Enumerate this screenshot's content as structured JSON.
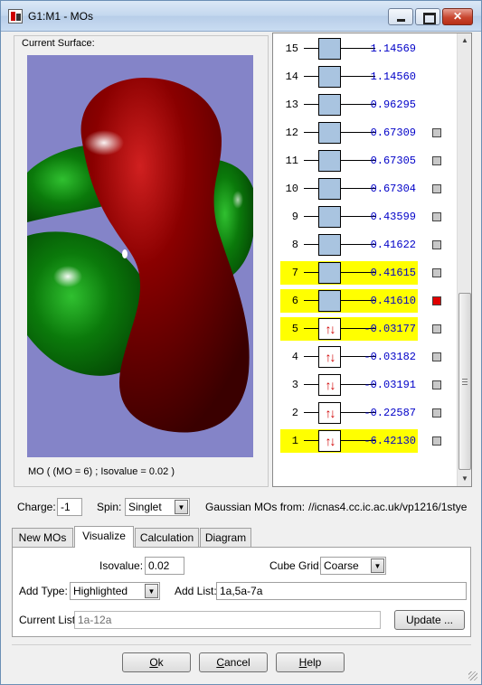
{
  "window": {
    "title": "G1:M1 - MOs"
  },
  "surface": {
    "label": "Current Surface:",
    "caption": "MO ( (MO = 6) ; Isovalue = 0.02 )"
  },
  "mo_levels": [
    {
      "num": "15",
      "energy": "1.14569",
      "occupied": false,
      "highlighted": false,
      "checkbox": false,
      "selected": false
    },
    {
      "num": "14",
      "energy": "1.14560",
      "occupied": false,
      "highlighted": false,
      "checkbox": false,
      "selected": false
    },
    {
      "num": "13",
      "energy": "0.96295",
      "occupied": false,
      "highlighted": false,
      "checkbox": false,
      "selected": false
    },
    {
      "num": "12",
      "energy": "0.67309",
      "occupied": false,
      "highlighted": false,
      "checkbox": true,
      "selected": false
    },
    {
      "num": "11",
      "energy": "0.67305",
      "occupied": false,
      "highlighted": false,
      "checkbox": true,
      "selected": false
    },
    {
      "num": "10",
      "energy": "0.67304",
      "occupied": false,
      "highlighted": false,
      "checkbox": true,
      "selected": false
    },
    {
      "num": "9",
      "energy": "0.43599",
      "occupied": false,
      "highlighted": false,
      "checkbox": true,
      "selected": false
    },
    {
      "num": "8",
      "energy": "0.41622",
      "occupied": false,
      "highlighted": false,
      "checkbox": true,
      "selected": false
    },
    {
      "num": "7",
      "energy": "0.41615",
      "occupied": false,
      "highlighted": true,
      "checkbox": true,
      "selected": false
    },
    {
      "num": "6",
      "energy": "0.41610",
      "occupied": false,
      "highlighted": true,
      "checkbox": true,
      "selected": true
    },
    {
      "num": "5",
      "energy": "-0.03177",
      "occupied": true,
      "highlighted": true,
      "checkbox": true,
      "selected": false
    },
    {
      "num": "4",
      "energy": "-0.03182",
      "occupied": true,
      "highlighted": false,
      "checkbox": true,
      "selected": false
    },
    {
      "num": "3",
      "energy": "-0.03191",
      "occupied": true,
      "highlighted": false,
      "checkbox": true,
      "selected": false
    },
    {
      "num": "2",
      "energy": "-0.22587",
      "occupied": true,
      "highlighted": false,
      "checkbox": true,
      "selected": false
    },
    {
      "num": "1",
      "energy": "-6.42130",
      "occupied": true,
      "highlighted": true,
      "checkbox": true,
      "selected": false
    }
  ],
  "electron_glyph": "↑↓",
  "controls": {
    "charge_label": "Charge:",
    "charge_value": "-1",
    "spin_label": "Spin:",
    "spin_value": "Singlet",
    "source_label": "Gaussian MOs from:",
    "source_path": "//icnas4.cc.ic.ac.uk/vp1216/1stye"
  },
  "tabs": [
    "New MOs",
    "Visualize",
    "Calculation",
    "Diagram"
  ],
  "visualize": {
    "isovalue_label": "Isovalue:",
    "isovalue": "0.02",
    "cube_grid_label": "Cube Grid:",
    "cube_grid": "Coarse",
    "add_type_label": "Add Type:",
    "add_type": "Highlighted",
    "add_list_label": "Add List:",
    "add_list": "1a,5a-7a",
    "current_list_label": "Current List:",
    "current_list": "1a-12a",
    "update_label": "Update ..."
  },
  "buttons": {
    "ok_mnemonic": "O",
    "ok_rest": "k",
    "cancel_mnemonic": "C",
    "cancel_rest": "ancel",
    "help_mnemonic": "H",
    "help_rest": "elp"
  },
  "colors": {
    "viewport_bg": "#8484c8",
    "lobe_red": "#7a0000",
    "lobe_green": "#0d7a0d",
    "highlight": "#ffff00",
    "energy_text": "#0000c8",
    "electron": "#d00000",
    "selected_check": "#e00000",
    "homo_line": "#1aa5a5"
  }
}
